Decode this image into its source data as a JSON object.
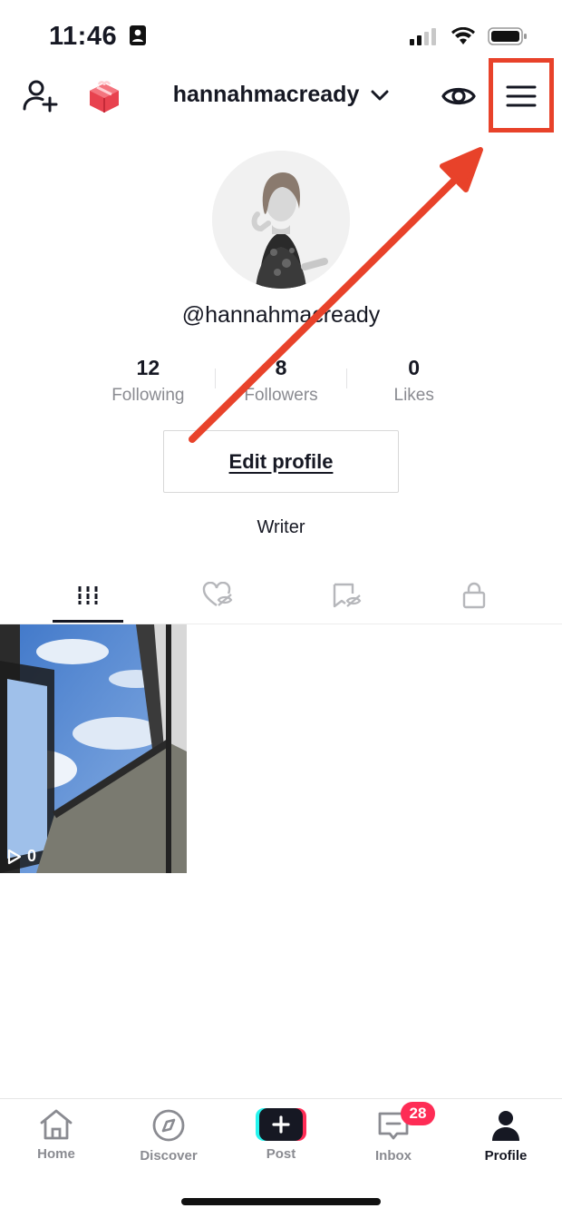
{
  "status_bar": {
    "time": "11:46"
  },
  "header": {
    "username": "hannahmacready",
    "icons": [
      "add-user-icon",
      "gift-icon",
      "chevron-down-icon",
      "eye-icon",
      "hamburger-menu-icon"
    ]
  },
  "profile": {
    "handle": "@hannahmacready",
    "stats": [
      {
        "value": "12",
        "label": "Following"
      },
      {
        "value": "8",
        "label": "Followers"
      },
      {
        "value": "0",
        "label": "Likes"
      }
    ],
    "edit_label": "Edit profile",
    "bio": "Writer"
  },
  "tabs": [
    {
      "name": "videos",
      "icon": "grid-icon",
      "active": true
    },
    {
      "name": "liked",
      "icon": "heart-hidden-icon",
      "active": false
    },
    {
      "name": "favorites",
      "icon": "bookmark-hidden-icon",
      "active": false
    },
    {
      "name": "private",
      "icon": "lock-icon",
      "active": false
    }
  ],
  "videos": [
    {
      "views": "0"
    }
  ],
  "bottom_nav": {
    "items": [
      {
        "label": "Home",
        "icon": "home-icon"
      },
      {
        "label": "Discover",
        "icon": "compass-icon"
      },
      {
        "label": "Post",
        "icon": "plus-icon"
      },
      {
        "label": "Inbox",
        "icon": "inbox-icon"
      },
      {
        "label": "Profile",
        "icon": "person-icon"
      }
    ],
    "inbox_badge": "28",
    "active": "Profile"
  },
  "annotation": {
    "highlight_color": "#e8422a"
  },
  "colors": {
    "accent": "#fe2c55",
    "text": "#161823",
    "muted": "#8a8b91"
  }
}
